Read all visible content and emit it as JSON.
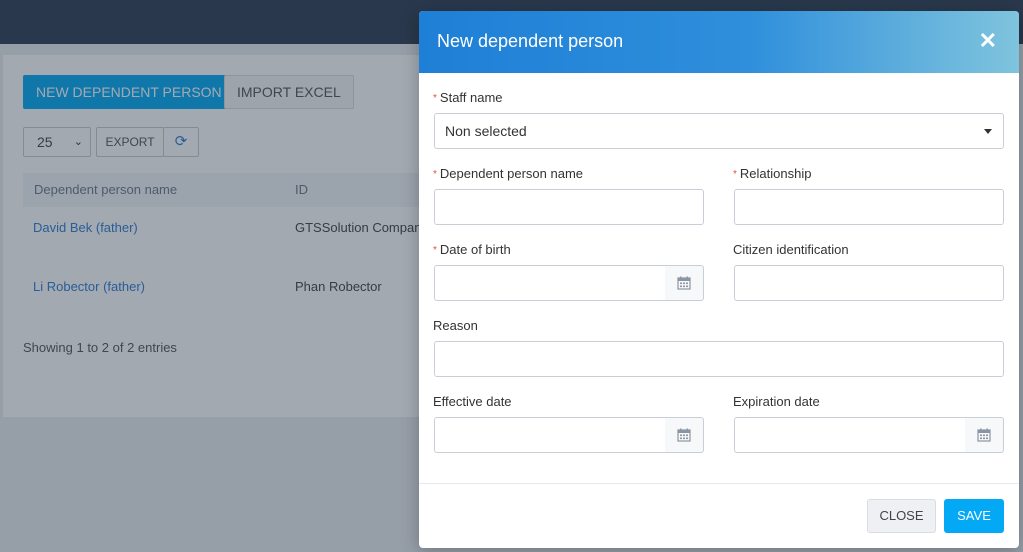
{
  "background": {
    "new_button_label": "NEW DEPENDENT PERSON",
    "import_button_label": "IMPORT EXCEL",
    "page_length_value": "25",
    "export_button_label": "EXPORT",
    "table": {
      "columns": [
        "Dependent person name",
        "ID"
      ],
      "rows": [
        {
          "name": "David Bek (father)",
          "id": "GTSSolution Compan"
        },
        {
          "name": "Li Robector (father)",
          "id": "Phan Robector"
        }
      ]
    },
    "showing_text": "Showing 1 to 2 of 2 entries"
  },
  "modal": {
    "title": "New dependent person",
    "fields": {
      "staff_name": {
        "label": "Staff name",
        "value": "Non selected"
      },
      "dependent_name": {
        "label": "Dependent person name",
        "value": ""
      },
      "relationship": {
        "label": "Relationship",
        "value": ""
      },
      "date_of_birth": {
        "label": "Date of birth",
        "value": ""
      },
      "citizen_id": {
        "label": "Citizen identification",
        "value": ""
      },
      "reason": {
        "label": "Reason",
        "value": ""
      },
      "effective_date": {
        "label": "Effective date",
        "value": ""
      },
      "expiration_date": {
        "label": "Expiration date",
        "value": ""
      }
    },
    "required_marker": "*",
    "close_button_label": "CLOSE",
    "save_button_label": "SAVE"
  },
  "colors": {
    "accent": "#03a9f4",
    "link": "#2e7dd1",
    "required": "#e74c3c"
  },
  "icons": {
    "close": "close-icon",
    "calendar": "calendar-icon",
    "refresh": "refresh-icon",
    "dropdown": "chevron-down-icon"
  }
}
